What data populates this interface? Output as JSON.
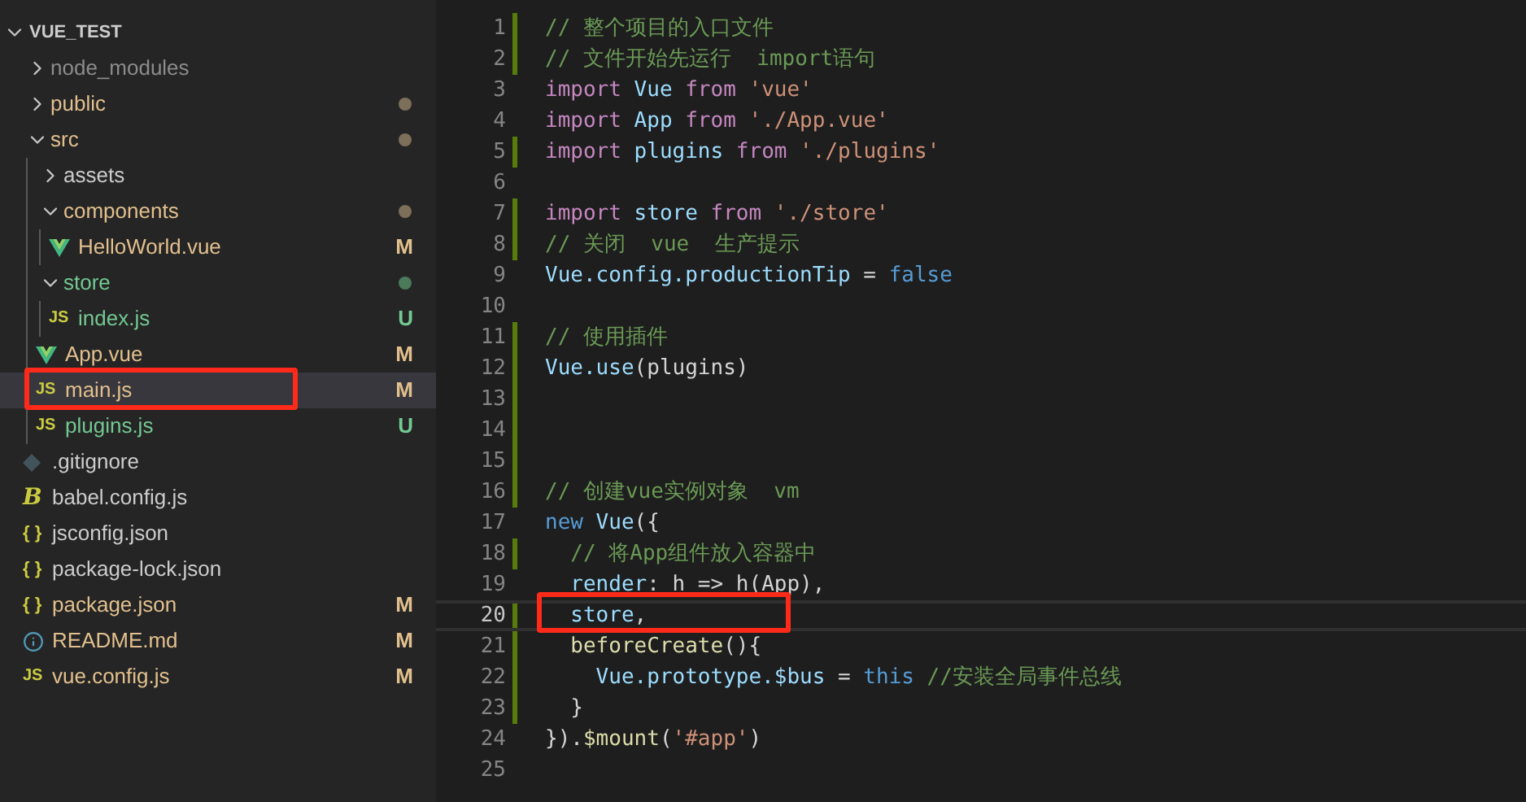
{
  "explorer": {
    "root": {
      "name": "VUE_TEST",
      "expanded": true
    },
    "items": [
      {
        "name": "node_modules",
        "kind": "folder",
        "expanded": false,
        "modified": false,
        "untracked": false,
        "ignored": true,
        "dot": false,
        "selected": false,
        "highlighted": false
      },
      {
        "name": "public",
        "kind": "folder",
        "expanded": false,
        "modified": true,
        "untracked": false,
        "ignored": false,
        "dot": true,
        "selected": false,
        "highlighted": false
      },
      {
        "name": "src",
        "kind": "folder",
        "expanded": true,
        "modified": true,
        "untracked": false,
        "ignored": false,
        "dot": true,
        "selected": false,
        "highlighted": false,
        "children": [
          {
            "name": "assets",
            "kind": "folder",
            "expanded": false,
            "modified": false,
            "untracked": false,
            "ignored": false,
            "dot": false,
            "selected": false,
            "highlighted": false
          },
          {
            "name": "components",
            "kind": "folder",
            "expanded": true,
            "modified": true,
            "untracked": false,
            "ignored": false,
            "dot": true,
            "selected": false,
            "highlighted": false,
            "children": [
              {
                "name": "HelloWorld.vue",
                "kind": "vue",
                "modified": true,
                "untracked": false,
                "ignored": false,
                "badge": "M",
                "selected": false,
                "highlighted": false
              }
            ]
          },
          {
            "name": "store",
            "kind": "folder",
            "expanded": true,
            "modified": false,
            "untracked": true,
            "ignored": false,
            "dot": true,
            "selected": false,
            "highlighted": false,
            "children": [
              {
                "name": "index.js",
                "kind": "js",
                "icon_text": "JS",
                "modified": false,
                "untracked": true,
                "ignored": false,
                "badge": "U",
                "selected": false,
                "highlighted": false
              }
            ]
          },
          {
            "name": "App.vue",
            "kind": "vue",
            "modified": true,
            "untracked": false,
            "ignored": false,
            "badge": "M",
            "selected": false,
            "highlighted": false
          },
          {
            "name": "main.js",
            "kind": "js",
            "icon_text": "JS",
            "modified": true,
            "untracked": false,
            "ignored": false,
            "badge": "M",
            "selected": true,
            "highlighted": true
          },
          {
            "name": "plugins.js",
            "kind": "js",
            "icon_text": "JS",
            "modified": false,
            "untracked": true,
            "ignored": false,
            "badge": "U",
            "selected": false,
            "highlighted": false
          }
        ]
      },
      {
        "name": ".gitignore",
        "kind": "git",
        "modified": false,
        "untracked": false,
        "ignored": false,
        "selected": false,
        "highlighted": false
      },
      {
        "name": "babel.config.js",
        "kind": "babel",
        "icon_text": "B",
        "modified": false,
        "untracked": false,
        "ignored": false,
        "selected": false,
        "highlighted": false
      },
      {
        "name": "jsconfig.json",
        "kind": "json",
        "icon_text": "{ }",
        "modified": false,
        "untracked": false,
        "ignored": false,
        "selected": false,
        "highlighted": false
      },
      {
        "name": "package-lock.json",
        "kind": "json",
        "icon_text": "{ }",
        "modified": false,
        "untracked": false,
        "ignored": false,
        "selected": false,
        "highlighted": false
      },
      {
        "name": "package.json",
        "kind": "json",
        "icon_text": "{ }",
        "modified": true,
        "untracked": false,
        "ignored": false,
        "badge": "M",
        "selected": false,
        "highlighted": false
      },
      {
        "name": "README.md",
        "kind": "info",
        "modified": true,
        "untracked": false,
        "ignored": false,
        "badge": "M",
        "selected": false,
        "highlighted": false
      },
      {
        "name": "vue.config.js",
        "kind": "js",
        "icon_text": "JS",
        "modified": true,
        "untracked": false,
        "ignored": false,
        "badge": "M",
        "selected": false,
        "highlighted": false
      }
    ]
  },
  "editor": {
    "lines": [
      {
        "number": "1",
        "changed": true,
        "current": false,
        "highlighted": false,
        "tokens": [
          {
            "text": "// 整个项目的入口文件",
            "kind": "comment"
          }
        ]
      },
      {
        "number": "2",
        "changed": true,
        "current": false,
        "highlighted": false,
        "tokens": [
          {
            "text": "// 文件开始先运行  import语句",
            "kind": "comment"
          }
        ]
      },
      {
        "number": "3",
        "changed": false,
        "current": false,
        "highlighted": false,
        "tokens": [
          {
            "text": "import",
            "kind": "keyword"
          },
          {
            "text": " Vue ",
            "kind": "variable"
          },
          {
            "text": "from",
            "kind": "keyword"
          },
          {
            "text": " 'vue'",
            "kind": "string"
          }
        ]
      },
      {
        "number": "4",
        "changed": false,
        "current": false,
        "highlighted": false,
        "tokens": [
          {
            "text": "import",
            "kind": "keyword"
          },
          {
            "text": " App ",
            "kind": "variable"
          },
          {
            "text": "from",
            "kind": "keyword"
          },
          {
            "text": " './App.vue'",
            "kind": "string"
          }
        ]
      },
      {
        "number": "5",
        "changed": true,
        "current": false,
        "highlighted": false,
        "tokens": [
          {
            "text": "import",
            "kind": "keyword"
          },
          {
            "text": " plugins ",
            "kind": "variable"
          },
          {
            "text": "from",
            "kind": "keyword"
          },
          {
            "text": " './plugins'",
            "kind": "string"
          }
        ]
      },
      {
        "number": "6",
        "changed": false,
        "current": false,
        "highlighted": false
      },
      {
        "number": "7",
        "changed": true,
        "current": false,
        "highlighted": false,
        "tokens": [
          {
            "text": "import",
            "kind": "keyword"
          },
          {
            "text": " store ",
            "kind": "variable"
          },
          {
            "text": "from",
            "kind": "keyword"
          },
          {
            "text": " './store'",
            "kind": "string"
          }
        ]
      },
      {
        "number": "8",
        "changed": true,
        "current": false,
        "highlighted": false,
        "tokens": [
          {
            "text": "// 关闭  vue  生产提示",
            "kind": "comment"
          }
        ]
      },
      {
        "number": "9",
        "changed": false,
        "current": false,
        "highlighted": false,
        "tokens": [
          {
            "text": "Vue.config.productionTip",
            "kind": "variable"
          },
          {
            "text": " = ",
            "kind": "plain"
          },
          {
            "text": "false",
            "kind": "constant"
          }
        ]
      },
      {
        "number": "10",
        "changed": false,
        "current": false,
        "highlighted": false
      },
      {
        "number": "11",
        "changed": true,
        "current": false,
        "highlighted": false,
        "tokens": [
          {
            "text": "// 使用插件",
            "kind": "comment"
          }
        ]
      },
      {
        "number": "12",
        "changed": true,
        "current": false,
        "highlighted": false,
        "tokens": [
          {
            "text": "Vue.use",
            "kind": "variable"
          },
          {
            "text": "(plugins)",
            "kind": "plain"
          }
        ]
      },
      {
        "number": "13",
        "changed": true,
        "current": false,
        "highlighted": false
      },
      {
        "number": "14",
        "changed": true,
        "current": false,
        "highlighted": false
      },
      {
        "number": "15",
        "changed": true,
        "current": false,
        "highlighted": false
      },
      {
        "number": "16",
        "changed": true,
        "current": false,
        "highlighted": false,
        "tokens": [
          {
            "text": "// 创建vue实例对象  vm",
            "kind": "comment"
          }
        ]
      },
      {
        "number": "17",
        "changed": false,
        "current": false,
        "highlighted": false,
        "tokens": [
          {
            "text": "new",
            "kind": "constant"
          },
          {
            "text": " Vue",
            "kind": "variable"
          },
          {
            "text": "({",
            "kind": "plain"
          }
        ]
      },
      {
        "number": "18",
        "changed": true,
        "current": false,
        "highlighted": false,
        "tokens": [
          {
            "text": "  // 将App组件放入容器中",
            "kind": "comment"
          }
        ]
      },
      {
        "number": "19",
        "changed": false,
        "current": false,
        "highlighted": false,
        "tokens": [
          {
            "text": "  render",
            "kind": "variable"
          },
          {
            "text": ": h => h(App),",
            "kind": "plain"
          }
        ]
      },
      {
        "number": "20",
        "changed": true,
        "current": true,
        "highlighted": true,
        "tokens": [
          {
            "text": "  store",
            "kind": "variable"
          },
          {
            "text": ",",
            "kind": "plain"
          }
        ]
      },
      {
        "number": "21",
        "changed": true,
        "current": false,
        "highlighted": false,
        "tokens": [
          {
            "text": "  beforeCreate",
            "kind": "function"
          },
          {
            "text": "(){",
            "kind": "plain"
          }
        ]
      },
      {
        "number": "22",
        "changed": true,
        "current": false,
        "highlighted": false,
        "tokens": [
          {
            "text": "    Vue.prototype.$bus",
            "kind": "variable"
          },
          {
            "text": " = ",
            "kind": "plain"
          },
          {
            "text": "this",
            "kind": "constant"
          },
          {
            "text": " //安装全局事件总线",
            "kind": "comment"
          }
        ]
      },
      {
        "number": "23",
        "changed": true,
        "current": false,
        "highlighted": false,
        "tokens": [
          {
            "text": "  }",
            "kind": "plain"
          }
        ]
      },
      {
        "number": "24",
        "changed": false,
        "current": false,
        "highlighted": false,
        "tokens": [
          {
            "text": "}).",
            "kind": "plain"
          },
          {
            "text": "$mount",
            "kind": "function"
          },
          {
            "text": "(",
            "kind": "plain"
          },
          {
            "text": "'#app'",
            "kind": "string"
          },
          {
            "text": ")",
            "kind": "plain"
          }
        ]
      },
      {
        "number": "25",
        "changed": false,
        "current": false,
        "highlighted": false
      }
    ]
  }
}
